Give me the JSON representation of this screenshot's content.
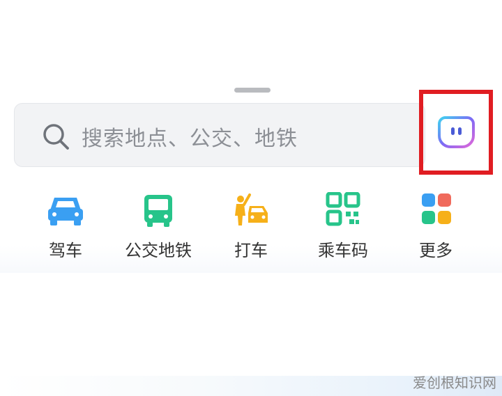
{
  "search": {
    "placeholder": "搜索地点、公交、地铁"
  },
  "quick_actions": [
    {
      "label": "驾车",
      "icon": "car-icon",
      "color": "#3a9ff2"
    },
    {
      "label": "公交地铁",
      "icon": "bus-icon",
      "color": "#27c48a"
    },
    {
      "label": "打车",
      "icon": "taxi-icon",
      "color": "#f6b019"
    },
    {
      "label": "乘车码",
      "icon": "qr-code-icon",
      "color": "#27c48a"
    },
    {
      "label": "更多",
      "icon": "more-grid-icon",
      "color": "#f06a5c"
    }
  ],
  "assistant": {
    "icon": "assistant-bot-icon",
    "highlight_color": "#e01d22"
  },
  "watermark": "爱创根知识网"
}
